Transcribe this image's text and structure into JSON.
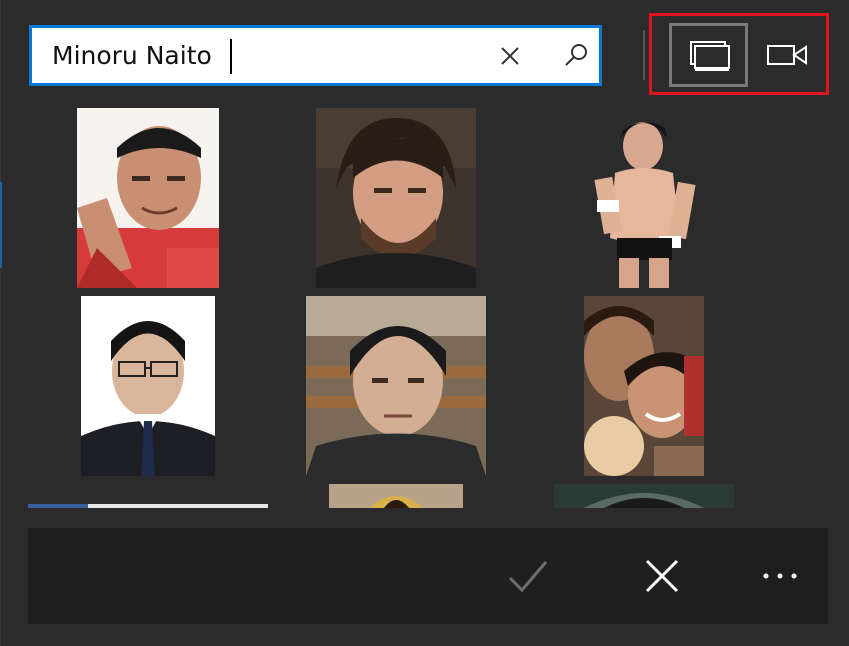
{
  "search": {
    "query": "Minoru Naito",
    "clear_icon": "close-icon",
    "submit_icon": "search-icon"
  },
  "mode_toggle": {
    "images_icon": "image-stack-icon",
    "videos_icon": "video-camera-icon",
    "selected": "images",
    "highlight_color": "#e0141e"
  },
  "results": {
    "count_visible": 9
  },
  "actions": {
    "confirm_icon": "check-icon",
    "cancel_icon": "close-icon",
    "more_icon": "more-ellipsis-icon"
  },
  "colors": {
    "background": "#2b2b2b",
    "accent": "#0a78d7",
    "bar": "#1f1f1f"
  }
}
